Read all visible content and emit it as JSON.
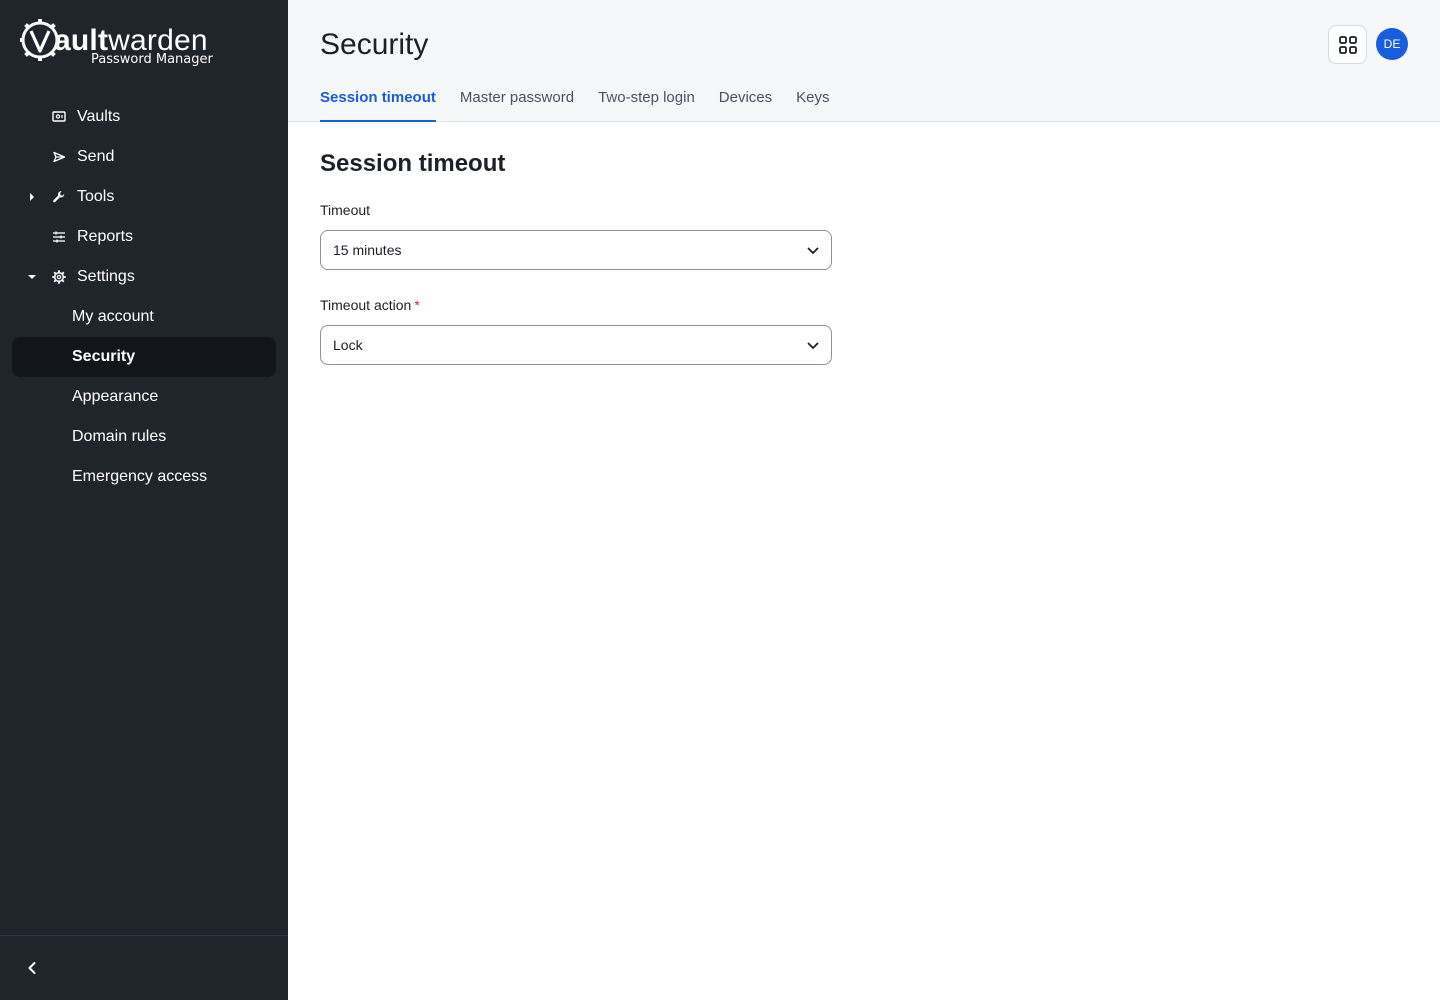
{
  "brand": {
    "name_bold": "V",
    "name_a": "ault",
    "name_b": "warden",
    "subtitle": "Password Manager"
  },
  "sidebar": {
    "items": [
      {
        "label": "Vaults",
        "icon": "vault-icon"
      },
      {
        "label": "Send",
        "icon": "send-icon"
      },
      {
        "label": "Tools",
        "icon": "wrench-icon",
        "caret": "collapsed"
      },
      {
        "label": "Reports",
        "icon": "sliders-icon"
      },
      {
        "label": "Settings",
        "icon": "gear-icon",
        "caret": "expanded"
      }
    ],
    "settings_children": [
      {
        "label": "My account"
      },
      {
        "label": "Security",
        "active": true
      },
      {
        "label": "Appearance"
      },
      {
        "label": "Domain rules"
      },
      {
        "label": "Emergency access"
      }
    ]
  },
  "header": {
    "title": "Security",
    "avatar_initials": "DE",
    "tabs": [
      {
        "label": "Session timeout",
        "active": true
      },
      {
        "label": "Master password"
      },
      {
        "label": "Two-step login"
      },
      {
        "label": "Devices"
      },
      {
        "label": "Keys"
      }
    ]
  },
  "form": {
    "section_title": "Session timeout",
    "timeout_label": "Timeout",
    "timeout_value": "15 minutes",
    "action_label": "Timeout action",
    "action_required_mark": "*",
    "action_value": "Lock"
  },
  "colors": {
    "sidebar_bg": "#20252c",
    "active_item_bg": "#121519",
    "accent": "#175ddc",
    "required": "#c83522"
  }
}
